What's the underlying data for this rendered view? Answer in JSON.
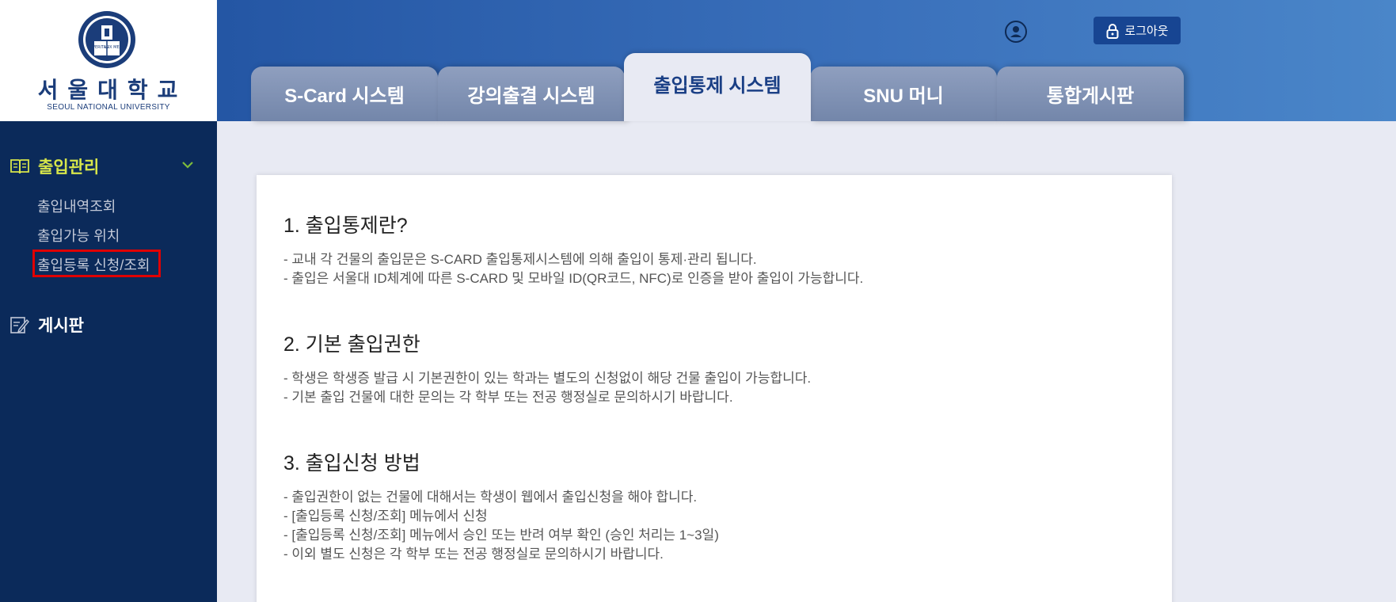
{
  "logo": {
    "korean": "서울대학교",
    "english": "SEOUL NATIONAL UNIVERSITY",
    "emblem_text": [
      "VERITAS",
      "LUX MEA"
    ]
  },
  "header": {
    "logout_label": "로그아웃",
    "tabs": [
      {
        "label": "S-Card 시스템"
      },
      {
        "label": "강의출결 시스템"
      },
      {
        "label": "출입통제 시스템",
        "active": true
      },
      {
        "label": "SNU 머니"
      },
      {
        "label": "통합게시판"
      }
    ]
  },
  "sidebar": {
    "menus": [
      {
        "label": "출입관리",
        "icon": "book-icon",
        "expanded": true,
        "items": [
          {
            "label": "출입내역조회"
          },
          {
            "label": "출입가능 위치"
          },
          {
            "label": "출입등록 신청/조회"
          }
        ]
      },
      {
        "label": "게시판",
        "icon": "edit-icon"
      }
    ]
  },
  "content": {
    "sections": [
      {
        "title": "1. 출입통제란?",
        "lines": [
          "- 교내 각 건물의 출입문은 S-CARD 출입통제시스템에 의해 출입이 통제·관리 됩니다.",
          "- 출입은 서울대 ID체계에 따른 S-CARD 및 모바일 ID(QR코드, NFC)로 인증을 받아 출입이 가능합니다."
        ]
      },
      {
        "title": "2. 기본 출입권한",
        "lines": [
          "- 학생은 학생증 발급 시 기본권한이 있는 학과는 별도의 신청없이 해당 건물 출입이 가능합니다.",
          "- 기본 출입 건물에 대한 문의는 각 학부 또는 전공 행정실로 문의하시기 바랍니다."
        ]
      },
      {
        "title": "3. 출입신청 방법",
        "lines": [
          "- 출입권한이 없는 건물에 대해서는 학생이 웹에서 출입신청을 해야 합니다.",
          "- [출입등록 신청/조회] 메뉴에서 신청",
          "- [출입등록 신청/조회] 메뉴에서 승인 또는 반려 여부 확인 (승인 처리는 1~3일)",
          "- 이외 별도 신청은 각 학부 또는 전공 행정실로 문의하시기 바랍니다."
        ]
      }
    ]
  },
  "colors": {
    "header_blue": "#2456a4",
    "sidebar_navy": "#0b2a5a",
    "menu_active": "#d7e64a",
    "highlight_red": "#e00000"
  }
}
